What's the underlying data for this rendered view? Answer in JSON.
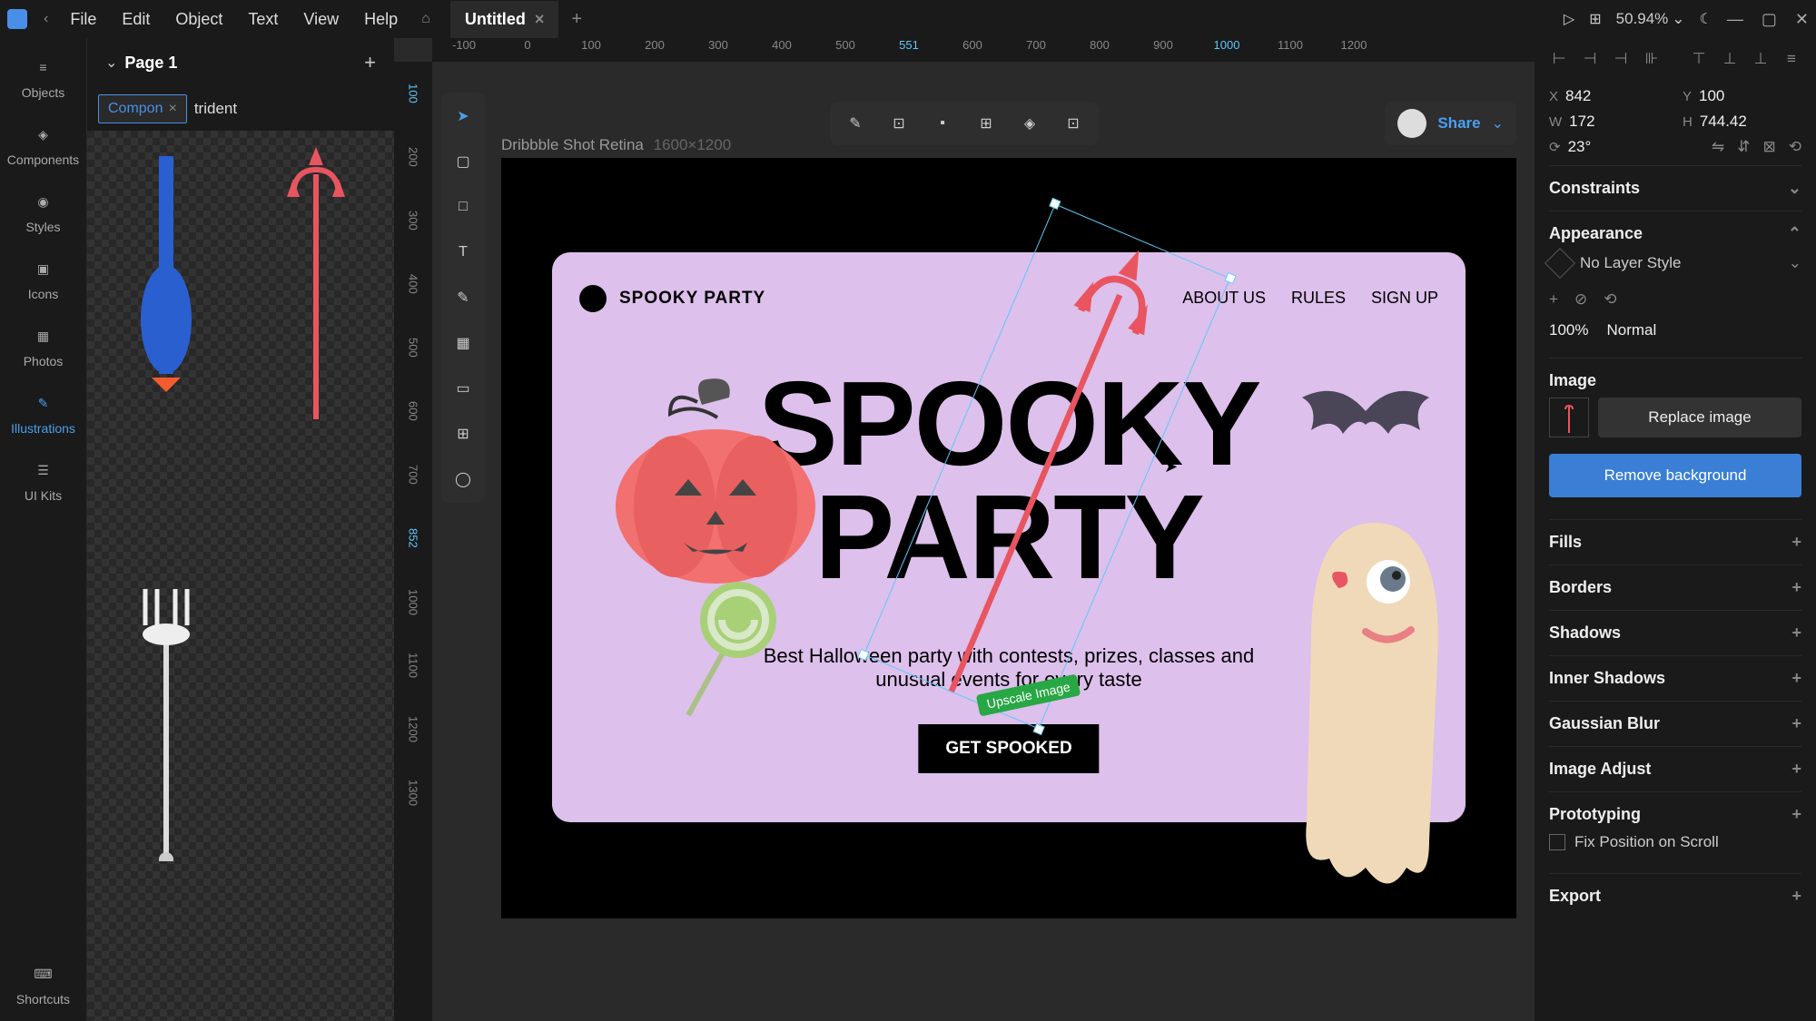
{
  "menu": {
    "file": "File",
    "edit": "Edit",
    "object": "Object",
    "text": "Text",
    "view": "View",
    "help": "Help"
  },
  "tab": {
    "title": "Untitled"
  },
  "zoom": "50.94%",
  "left_rail": {
    "objects": "Objects",
    "components": "Components",
    "styles": "Styles",
    "icons": "Icons",
    "photos": "Photos",
    "illustrations": "Illustrations",
    "uikits": "UI Kits",
    "shortcuts": "Shortcuts"
  },
  "left_panel": {
    "page_title": "Page 1",
    "search_chip": "Compon",
    "search_query": "trident"
  },
  "canvas": {
    "frame_name": "Dribbble Shot Retina",
    "frame_size": "1600×1200",
    "share": "Share",
    "upscale_label": "Upscale Image",
    "ruler_h": [
      "-100",
      "0",
      "100",
      "200",
      "300",
      "400",
      "500",
      "551",
      "600",
      "700",
      "800",
      "900",
      "1000",
      "1100",
      "1200"
    ],
    "ruler_v": [
      "100",
      "200",
      "300",
      "400",
      "500",
      "600",
      "700",
      "852",
      "1000",
      "1100",
      "1200",
      "1300"
    ]
  },
  "design": {
    "brand": "SPOOKY PARTY",
    "nav": {
      "about": "ABOUT US",
      "rules": "RULES",
      "signup": "SIGN UP"
    },
    "hero_line1": "SPOOKY",
    "hero_line2": "PARTY",
    "subtitle": "Best Halloween party with contests, prizes, classes and unusual events for every taste",
    "cta": "GET SPOOKED"
  },
  "props": {
    "x": "842",
    "y": "100",
    "w": "172",
    "h": "744.42",
    "rotation": "23°",
    "constraints": "Constraints",
    "appearance": "Appearance",
    "no_layer_style": "No Layer Style",
    "opacity": "100%",
    "blend": "Normal",
    "image": "Image",
    "replace": "Replace image",
    "remove_bg": "Remove background",
    "fills": "Fills",
    "borders": "Borders",
    "shadows": "Shadows",
    "inner_shadows": "Inner Shadows",
    "gaussian_blur": "Gaussian Blur",
    "image_adjust": "Image Adjust",
    "prototyping": "Prototyping",
    "fix_position": "Fix Position on Scroll",
    "export": "Export"
  }
}
